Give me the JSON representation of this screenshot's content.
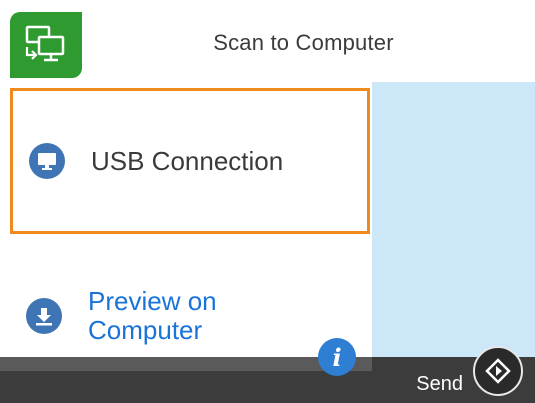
{
  "header": {
    "title": "Scan to Computer",
    "icon": "scan-to-computer-icon",
    "icon_bg_color": "#2e9a2f"
  },
  "list": {
    "items": [
      {
        "label": "USB Connection",
        "icon": "monitor-icon",
        "selected": true,
        "selection_color": "#f08a1c"
      },
      {
        "label_line1": "Preview on",
        "label_line2": "Computer",
        "icon": "download-icon",
        "text_color": "#1a73d9"
      }
    ]
  },
  "info_button": {
    "glyph": "i",
    "icon": "info-icon"
  },
  "bottom_bar": {
    "send_label": "Send",
    "send_icon": "start-diamond-icon"
  },
  "colors": {
    "right_panel": "#cbe7f8",
    "bottom_bar": "#3c3c3c",
    "accent_blue": "#3f75b5"
  }
}
